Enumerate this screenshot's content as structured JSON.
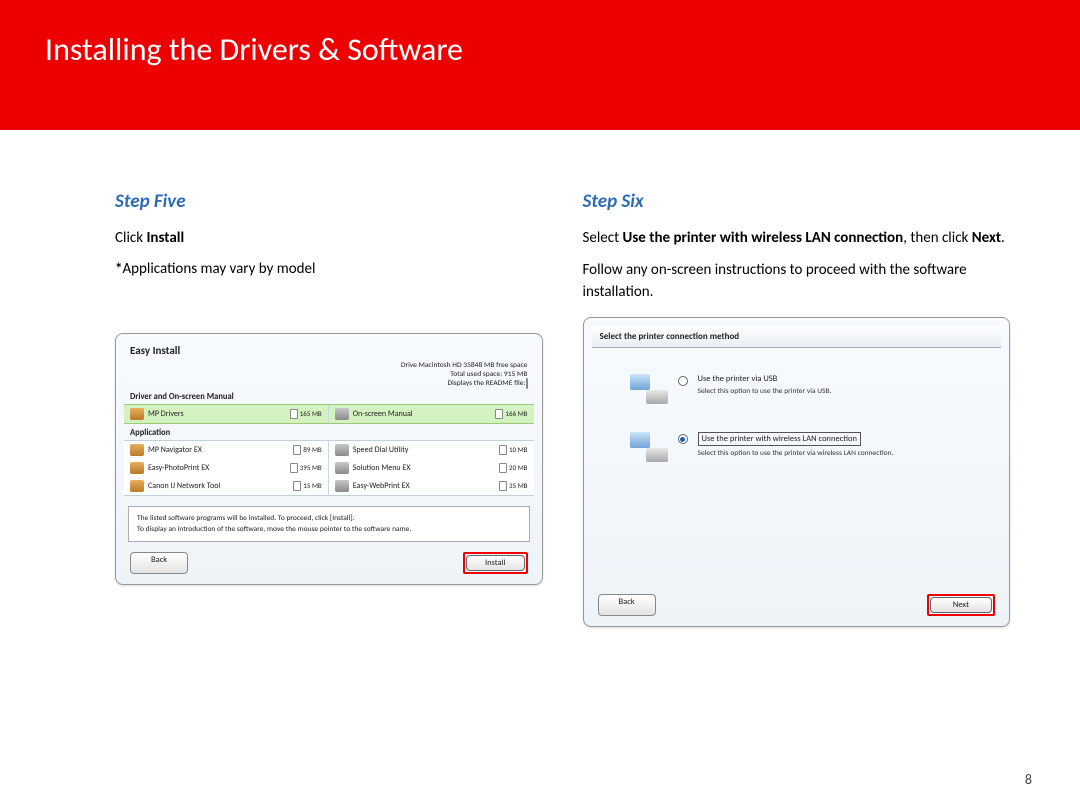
{
  "page": {
    "title": "Installing  the Drivers & Software",
    "number": "8"
  },
  "step5": {
    "heading": "Step Five",
    "instruction_pre": "Click ",
    "instruction_bold": "Install",
    "note_prefix": "*",
    "note_text": "Applications may vary by model"
  },
  "step6": {
    "heading": "Step Six",
    "line1_pre": "Select ",
    "line1_bold1": "Use the printer with wireless LAN connection",
    "line1_mid": ", then click ",
    "line1_bold2": "Next",
    "line1_post": ".",
    "line2": "Follow any on-screen instructions to proceed with the software installation."
  },
  "easy_install": {
    "title": "Easy Install",
    "info1": "Drive Macintosh HD 35848 MB free space",
    "info2": "Total used space: 915 MB",
    "info3": "Displays the README file:",
    "sec1": "Driver and On-screen Manual",
    "sec2": "Application",
    "drivers": [
      {
        "name": "MP Drivers",
        "size": "165 MB"
      },
      {
        "name": "On-screen Manual",
        "size": "166 MB"
      }
    ],
    "apps": [
      {
        "name": "MP Navigator EX",
        "size": "89 MB"
      },
      {
        "name": "Speed Dial Utility",
        "size": "10 MB"
      },
      {
        "name": "Easy-PhotoPrint EX",
        "size": "395 MB"
      },
      {
        "name": "Solution Menu EX",
        "size": "20 MB"
      },
      {
        "name": "Canon IJ Network Tool",
        "size": "15 MB"
      },
      {
        "name": "Easy-WebPrint EX",
        "size": "35 MB"
      }
    ],
    "help1": "The listed software programs will be installed. To proceed, click [Install].",
    "help2": "To display an introduction of the software, move the mouse pointer to the software name.",
    "back": "Back",
    "install": "Install"
  },
  "conn": {
    "heading": "Select the printer connection method",
    "usb_label": "Use the printer via USB",
    "usb_desc": "Select this option to use the printer via USB.",
    "lan_label": "Use the printer with wireless LAN connection",
    "lan_desc": "Select this option to use the printer via wireless LAN connection.",
    "back": "Back",
    "next": "Next"
  }
}
